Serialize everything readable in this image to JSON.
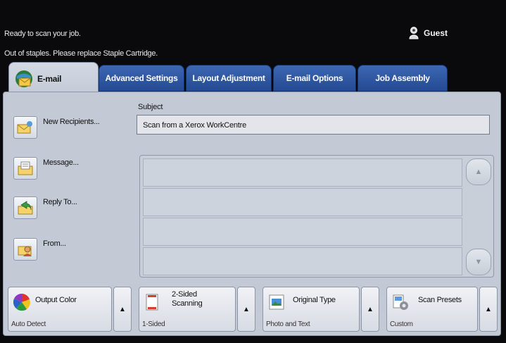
{
  "status": {
    "line1": "Ready to scan your job.",
    "line2": "Out of staples. Please replace Staple Cartridge."
  },
  "user": {
    "name": "Guest",
    "icon": "user-key-icon"
  },
  "tabs": [
    {
      "label": "E-mail",
      "active": true,
      "icon": "email-globe-icon"
    },
    {
      "label": "Advanced Settings",
      "active": false
    },
    {
      "label": "Layout Adjustment",
      "active": false
    },
    {
      "label": "E-mail Options",
      "active": false
    },
    {
      "label": "Job Assembly",
      "active": false
    }
  ],
  "side_buttons": [
    {
      "label": "New Recipients...",
      "icon": "recipients-icon"
    },
    {
      "label": "Message...",
      "icon": "message-icon"
    },
    {
      "label": "Reply To...",
      "icon": "reply-to-icon"
    },
    {
      "label": "From...",
      "icon": "from-icon"
    }
  ],
  "subject": {
    "label": "Subject",
    "value": "Scan from a Xerox WorkCentre"
  },
  "scroll": {
    "up": "▲",
    "down": "▼"
  },
  "bottom_buttons": [
    {
      "title": "Output Color",
      "value": "Auto Detect",
      "icon": "color-wheel-icon"
    },
    {
      "title_line1": "2-Sided",
      "title_line2": "Scanning",
      "value": "1-Sided",
      "icon": "two-sided-icon"
    },
    {
      "title": "Original Type",
      "value": "Photo and Text",
      "icon": "original-type-icon"
    },
    {
      "title": "Scan Presets",
      "value": "Custom",
      "icon": "scan-presets-icon"
    }
  ],
  "arrow_glyph": "▲",
  "colors": {
    "tab_blue": "#2f5aa6",
    "panel": "#c4cad5",
    "background": "#0a0a0c"
  }
}
